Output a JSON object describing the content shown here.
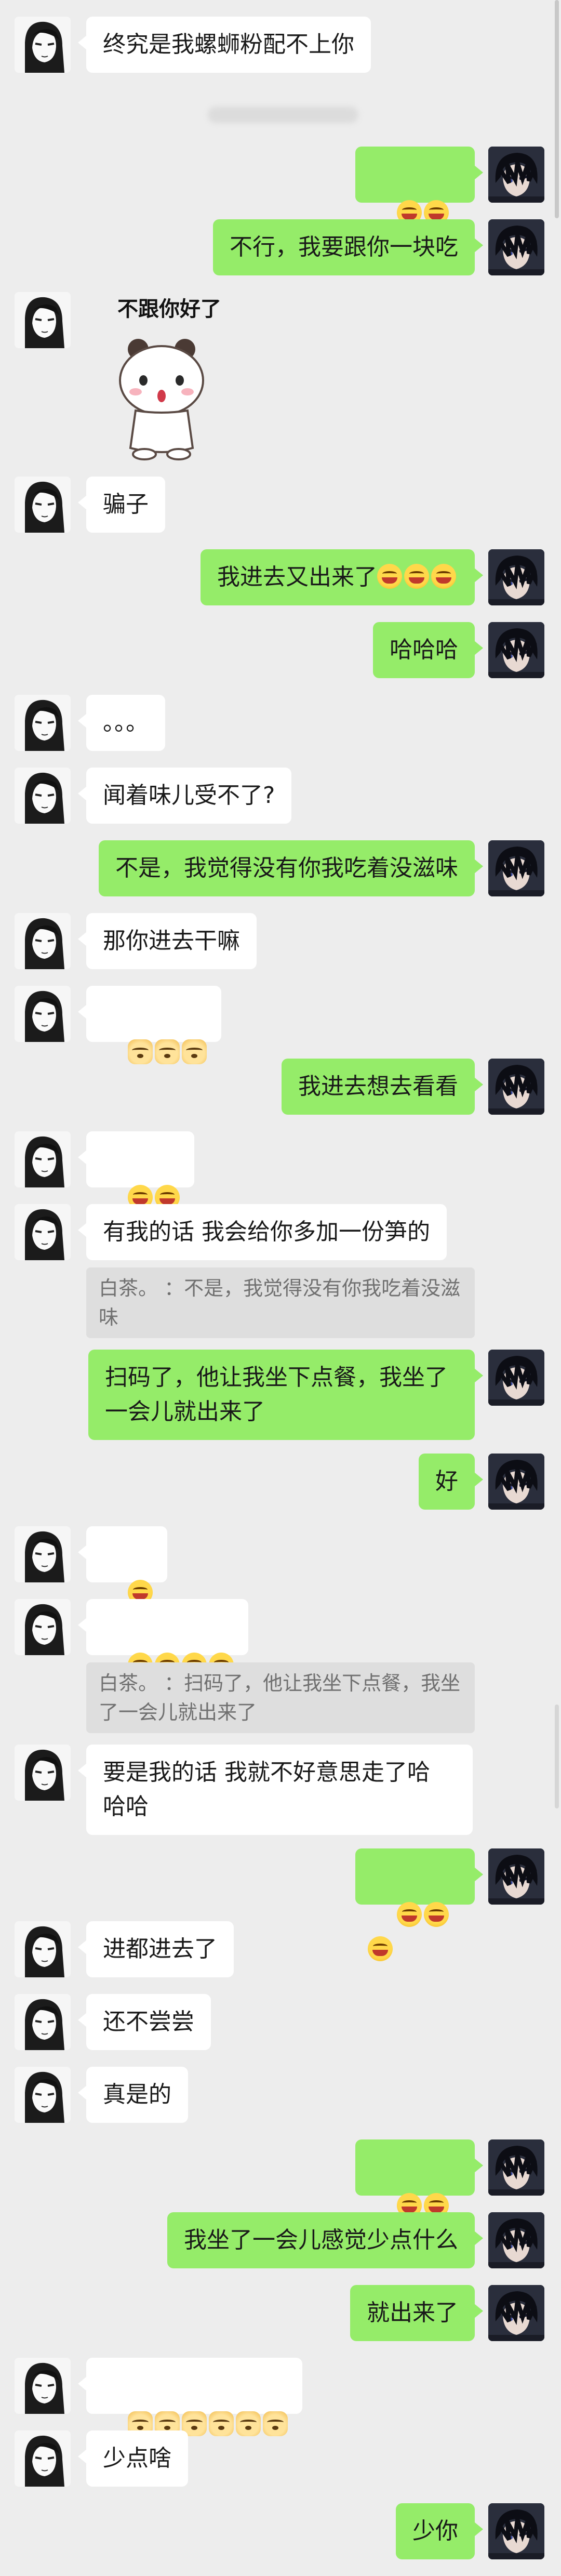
{
  "messages": {
    "m1": "终究是我螺蛳粉配不上你",
    "m3": "不行，我要跟你一块吃",
    "sticker_text": "不跟你好了",
    "m5": "骗子",
    "m6": "我进去又出来了",
    "m7": "哈哈哈",
    "m8": "。。。",
    "m9": "闻着味儿受不了?",
    "m10": "不是，我觉得没有你我吃着没滋味",
    "m11": "那你进去干嘛",
    "m13": "我进去想去看看",
    "m15": "有我的话 我会给你多加一份笋的",
    "q15": "白茶。      ：不是，我觉得没有你我吃着没滋味",
    "m16": "扫码了，他让我坐下点餐，我坐了\n一会儿就出来了",
    "m17": "好",
    "q19": "白茶。      ：扫码了，他让我坐下点餐，我坐了一会儿就出来了",
    "m20": "要是我的话 我就不好意思走了哈\n哈哈",
    "m22": "进都进去了",
    "m23": "还不尝尝",
    "m24": "真是的",
    "m26": "我坐了一会儿感觉少点什么",
    "m27": "就出来了",
    "m29": "少点啥",
    "m30": "少你"
  },
  "colors": {
    "background": "#ededed",
    "self_bubble": "#95ec69",
    "other_bubble": "#ffffff",
    "quote_bg": "#dedede"
  },
  "icons": {
    "laugh": "tears-of-joy-emoji",
    "dog": "doge-emoji",
    "avatar_left": "manga-girl-avatar",
    "avatar_right": "anime-boy-avatar"
  }
}
